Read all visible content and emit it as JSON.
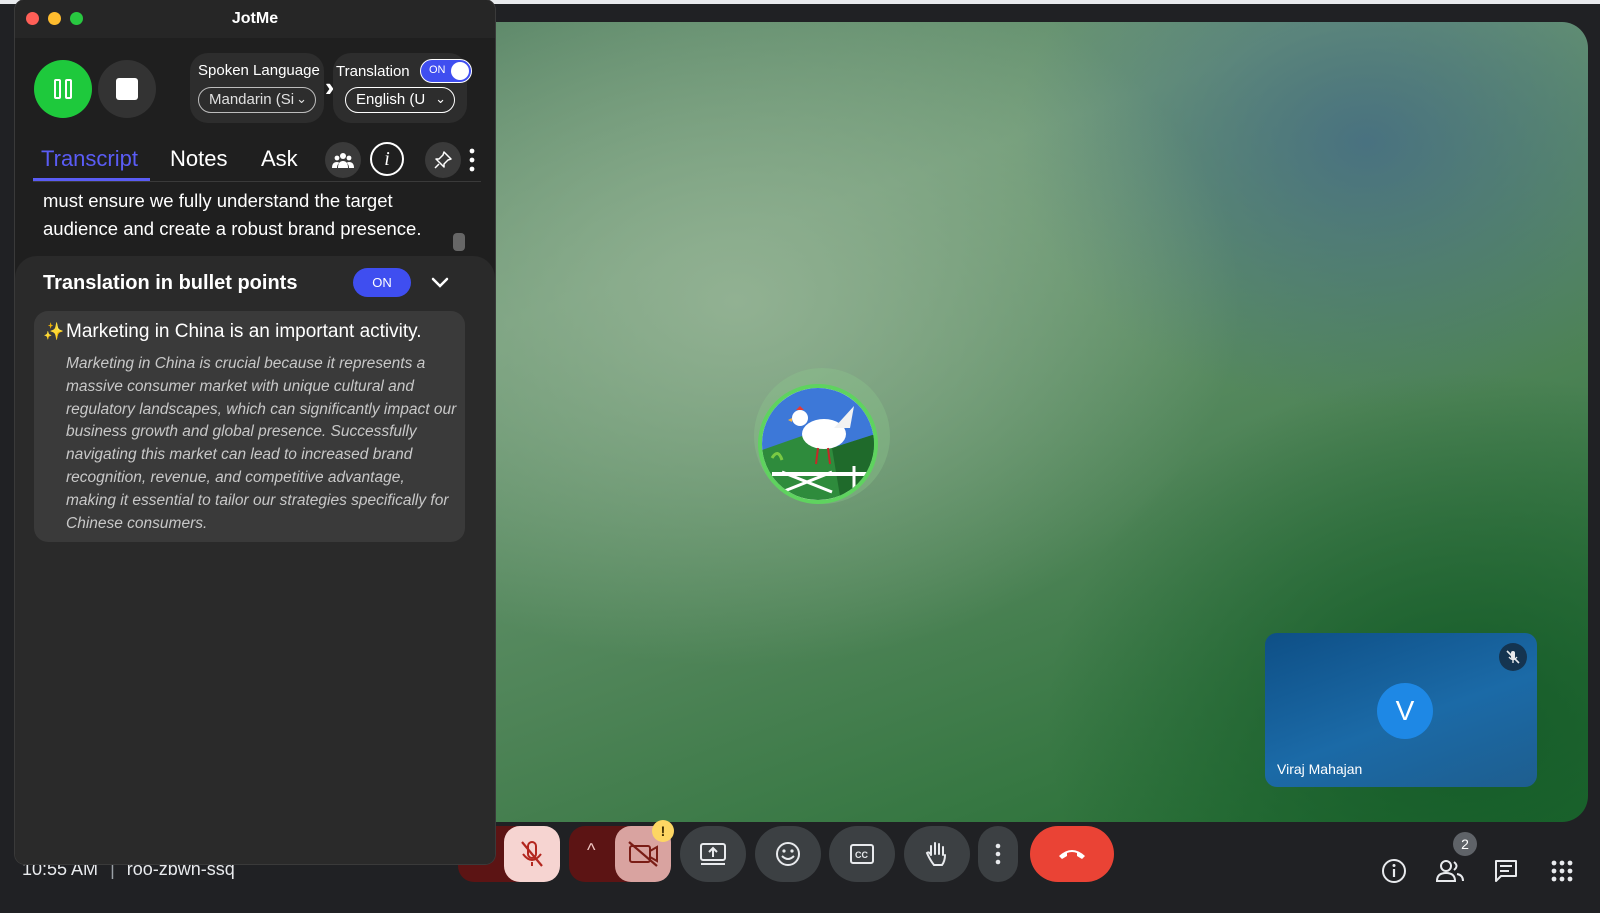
{
  "jotme": {
    "title": "JotMe",
    "spoken_language_label": "Spoken Language",
    "spoken_language_value": "Mandarin (Si",
    "translation_label": "Translation",
    "translation_toggle": "ON",
    "translation_language_value": "English (U",
    "tabs": [
      "Transcript",
      "Notes",
      "Ask"
    ],
    "transcript_text": "must ensure we fully understand the target audience and create a robust brand presence.",
    "bullet_panel": {
      "title": "Translation in bullet points",
      "toggle": "ON",
      "bullets": [
        {
          "heading": "Marketing in China is an important activity.",
          "detail": "Marketing in China is crucial because it represents a massive consumer market with unique cultural and regulatory landscapes, which can significantly impact our business growth and global presence. Successfully navigating this market can lead to increased brand recognition, revenue, and competitive advantage, making it essential to tailor our strategies specifically for Chinese consumers."
        }
      ]
    },
    "accent_color": "#3f4ef0",
    "record_color": "#1ec93c"
  },
  "meet": {
    "time": "10:55 AM",
    "separator": "|",
    "meeting_code": "roo-zbwn-ssq",
    "self_tile": {
      "initial": "V",
      "name": "Viraj Mahajan"
    },
    "participants_count": "2",
    "camera_warning": "!",
    "end_call_color": "#ea4335"
  }
}
